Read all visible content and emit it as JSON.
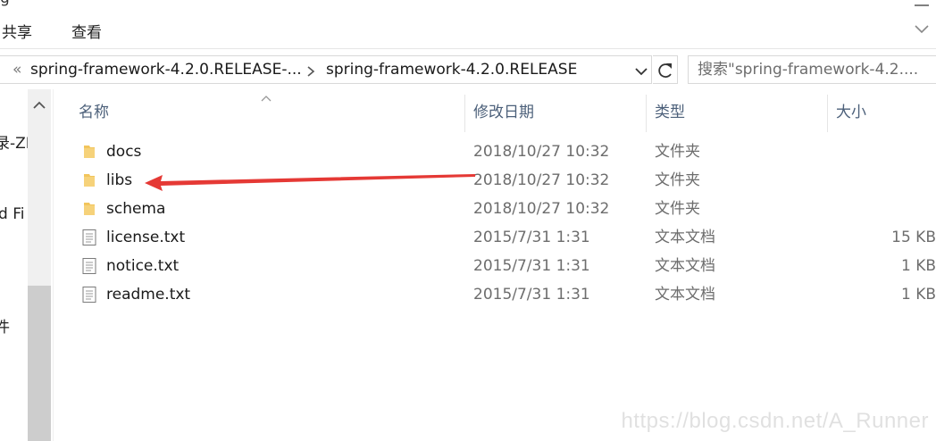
{
  "ribbon": {
    "top_fragment": "g",
    "tabs": [
      {
        "label": "共享"
      },
      {
        "label": "查看"
      }
    ]
  },
  "address": {
    "overflow": "«",
    "crumb_parent": "spring-framework-4.2.0.RELEASE-...",
    "crumb_current": "spring-framework-4.2.0.RELEASE"
  },
  "search": {
    "placeholder": "搜索\"spring-framework-4.2...."
  },
  "nav_fragments": [
    "录-ZL",
    "d Fi",
    "件"
  ],
  "columns": {
    "name": "名称",
    "date": "修改日期",
    "type": "类型",
    "size": "大小"
  },
  "files": [
    {
      "name": "docs",
      "date": "2018/10/27 10:32",
      "type": "文件夹",
      "size": "",
      "icon": "folder-icon"
    },
    {
      "name": "libs",
      "date": "2018/10/27 10:32",
      "type": "文件夹",
      "size": "",
      "icon": "folder-icon"
    },
    {
      "name": "schema",
      "date": "2018/10/27 10:32",
      "type": "文件夹",
      "size": "",
      "icon": "folder-icon"
    },
    {
      "name": "license.txt",
      "date": "2015/7/31 1:31",
      "type": "文本文档",
      "size": "15 KB",
      "icon": "text-file-icon"
    },
    {
      "name": "notice.txt",
      "date": "2015/7/31 1:31",
      "type": "文本文档",
      "size": "1 KB",
      "icon": "text-file-icon"
    },
    {
      "name": "readme.txt",
      "date": "2015/7/31 1:31",
      "type": "文本文档",
      "size": "1 KB",
      "icon": "text-file-icon"
    }
  ],
  "watermark": "https://blog.csdn.net/A_Runner",
  "colors": {
    "arrow": "#e53935",
    "folder": "#f2c55c",
    "header_text": "#4c607a"
  }
}
